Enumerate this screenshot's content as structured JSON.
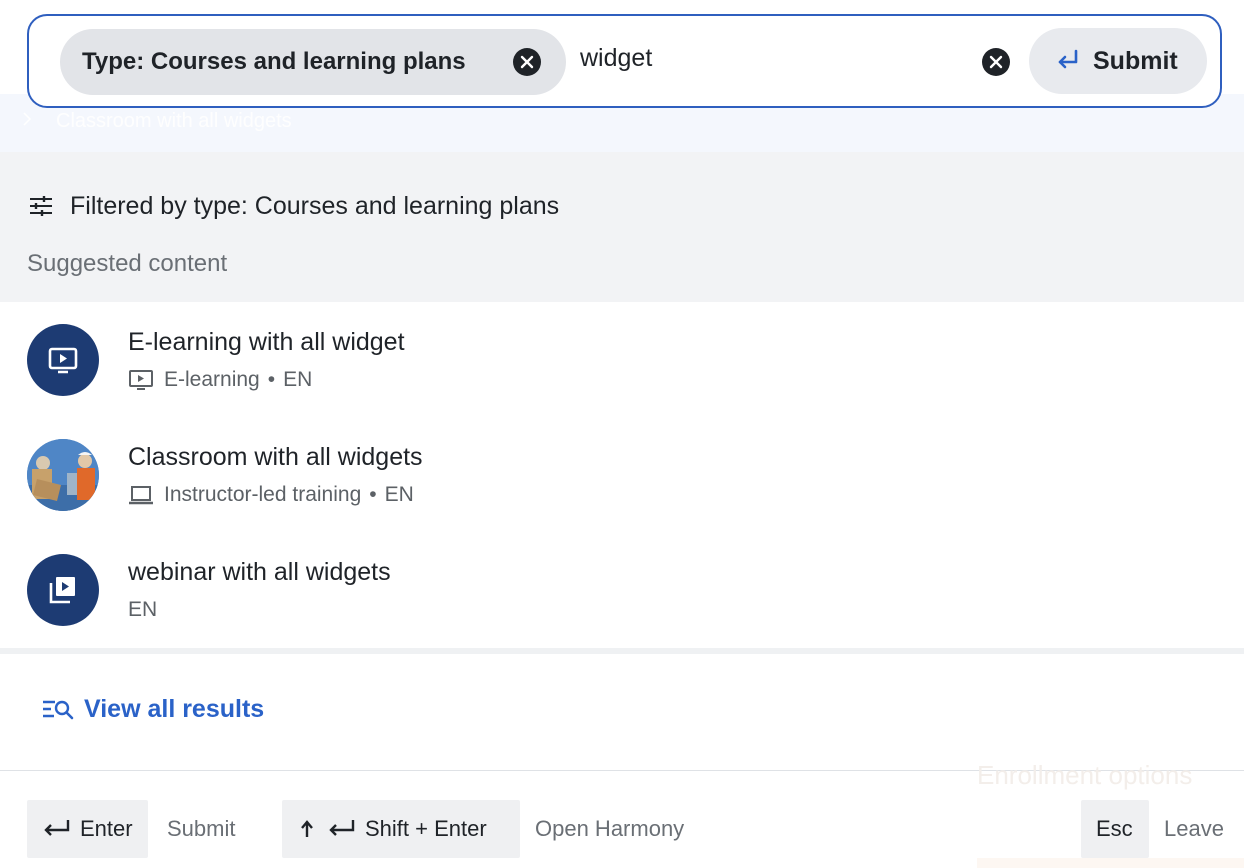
{
  "background": {
    "ghost_item_label": "Classroom with all widgets",
    "ghost_panel_label": "Enrollment options"
  },
  "search": {
    "chip_label": "Type: Courses and learning plans",
    "query": "widget",
    "submit_label": "Submit"
  },
  "filter": {
    "text": "Filtered by type: Courses and learning plans",
    "suggested_heading": "Suggested content"
  },
  "results": [
    {
      "title": "E-learning with all widget",
      "type": "E-learning",
      "language": "EN",
      "icon": "play-screen-icon"
    },
    {
      "title": "Classroom with all widgets",
      "type": "Instructor-led training",
      "language": "EN",
      "icon": "laptop-icon"
    },
    {
      "title": "webinar with all widgets",
      "type": "",
      "language": "EN",
      "icon": "video-stack-icon"
    }
  ],
  "view_all": {
    "label": "View all results"
  },
  "shortcuts": [
    {
      "key": "Enter",
      "desc": "Submit"
    },
    {
      "key": "Shift + Enter",
      "desc": "Open Harmony"
    },
    {
      "key": "Esc",
      "desc": "Leave"
    }
  ],
  "colors": {
    "accent": "#2a62c8",
    "border": "#2f5fbf",
    "avatar": "#1d3b73"
  }
}
